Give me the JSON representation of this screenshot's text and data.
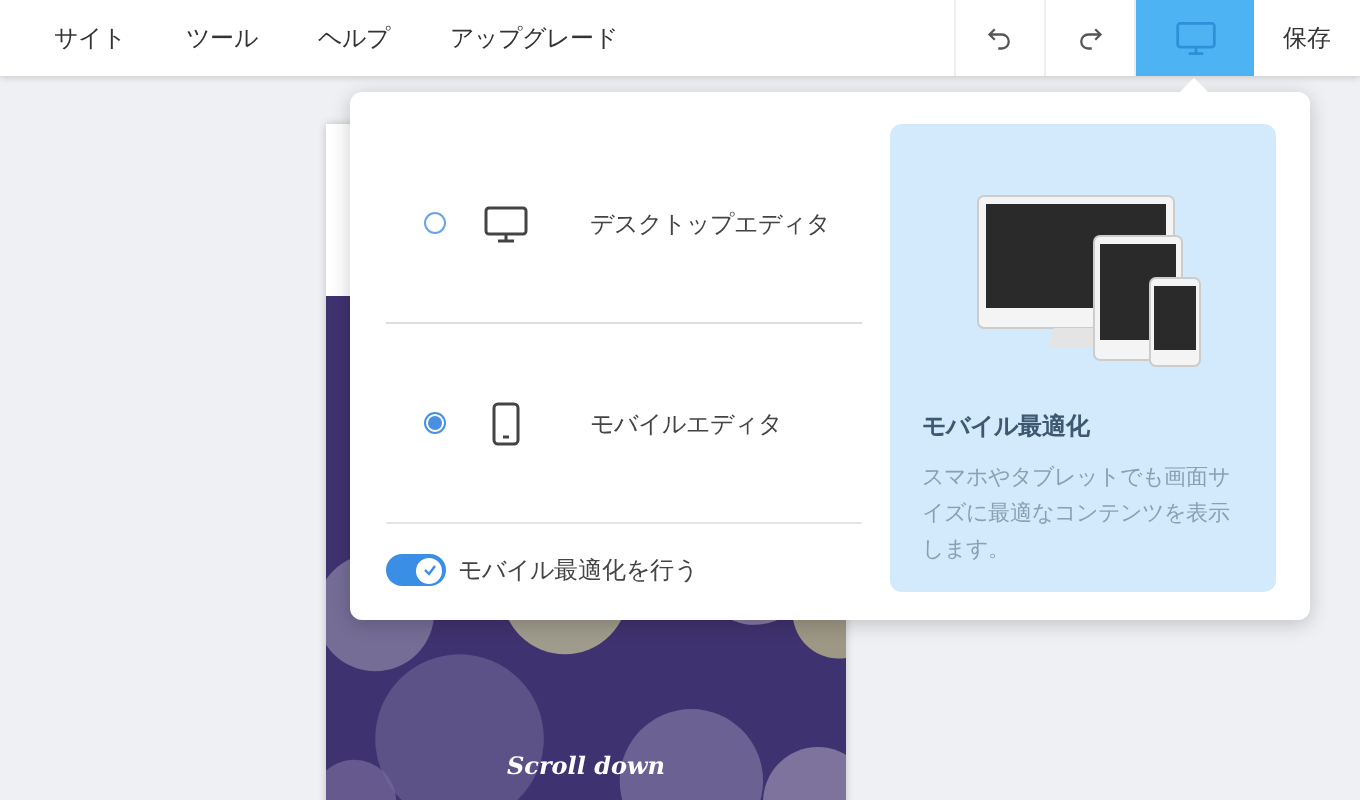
{
  "menu": [
    {
      "label": "サイト"
    },
    {
      "label": "ツール"
    },
    {
      "label": "ヘルプ"
    },
    {
      "label": "アップグレード"
    }
  ],
  "toolbar": [
    {
      "kind": "undo",
      "selected": false
    },
    {
      "kind": "redo",
      "selected": false
    },
    {
      "kind": "desktop",
      "selected": true
    }
  ],
  "save": "保存",
  "editor_options": [
    {
      "label": "デスクトップエディタ",
      "kind": "desktop",
      "selected": false
    },
    {
      "label": "モバイルエディタ",
      "kind": "mobile",
      "selected": true
    }
  ],
  "toggle": {
    "label": "モバイル最適化を行う",
    "on": true
  },
  "info": {
    "title": "モバイル最適化",
    "description": "スマホやタブレットでも画面サイズに最適なコンテンツを表示します。"
  },
  "preview": {
    "caption": "Scroll down"
  }
}
